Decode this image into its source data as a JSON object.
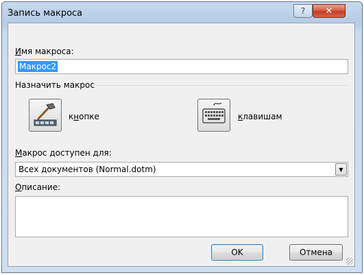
{
  "window": {
    "title": "Запись макроса",
    "help_glyph": "?",
    "close_glyph": "✕"
  },
  "macro_name": {
    "label_accel": "И",
    "label_rest": "мя макроса:",
    "value": "Макрос2"
  },
  "assign": {
    "group_label": "Назначить макрос",
    "button_label_pre": "к",
    "button_label_accel": "н",
    "button_label_post": "опке",
    "keyboard_label_accel": "к",
    "keyboard_label_rest": "лавишам",
    "button_icon": "hammer-toolbar-icon",
    "keyboard_icon": "keyboard-icon"
  },
  "store_in": {
    "label_accel": "М",
    "label_rest": "акрос доступен для:",
    "selected": "Всех документов (Normal.dotm)"
  },
  "description": {
    "label_accel": "О",
    "label_rest": "писание:",
    "value": ""
  },
  "buttons": {
    "ok": "OK",
    "cancel": "Отмена"
  }
}
